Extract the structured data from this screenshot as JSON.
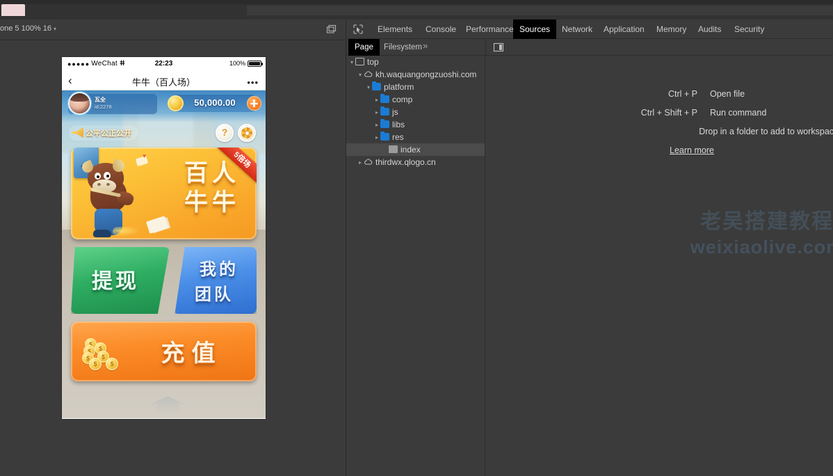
{
  "browser": {
    "tab_partial": ""
  },
  "device_bar": {
    "device_label": "one 5 100% 16",
    "caret": "▾",
    "screencast_icon": "screencast-icon"
  },
  "phone": {
    "status_bar": {
      "signal_dots": "●●●●●",
      "carrier": "WeChat",
      "wifi_icon": "ⵌ",
      "time": "22:23",
      "battery_percent": "100%"
    },
    "nav_bar": {
      "back_icon": "‹",
      "title": "牛牛（百人场）",
      "more_icon": "•••"
    },
    "hud": {
      "player_name": "瓦全",
      "player_id": "id:2278",
      "coin_amount": "50,000.00",
      "coin_plus": "+"
    },
    "notice": {
      "text": "公平公正公开",
      "help_label": "?",
      "settings_label": "gear"
    },
    "main_banner": {
      "title_line1": "百人",
      "title_line2": "牛牛",
      "ribbon": "5倍场"
    },
    "buttons": {
      "withdraw": "提现",
      "team_line1": "我的",
      "team_line2": "团队",
      "recharge": "充值"
    }
  },
  "devtools": {
    "inspect_icon": "inspect-element-icon",
    "tabs": [
      {
        "label": "Elements",
        "active": false
      },
      {
        "label": "Console",
        "active": false
      },
      {
        "label": "Performance",
        "active": false
      },
      {
        "label": "Sources",
        "active": true
      },
      {
        "label": "Network",
        "active": false
      },
      {
        "label": "Application",
        "active": false
      },
      {
        "label": "Memory",
        "active": false
      },
      {
        "label": "Audits",
        "active": false
      },
      {
        "label": "Security",
        "active": false
      }
    ],
    "sub_tabs": [
      {
        "label": "Page",
        "active": true
      },
      {
        "label": "Filesystem",
        "active": false
      }
    ],
    "sub_more": "»",
    "tree": [
      {
        "label": "top",
        "indent": 0,
        "twisty": "▾",
        "icon": "frame-icon",
        "selected": false
      },
      {
        "label": "kh.waquangongzuoshi.com",
        "indent": 1,
        "twisty": "▾",
        "icon": "cloud-icon",
        "selected": false
      },
      {
        "label": "platform",
        "indent": 2,
        "twisty": "▾",
        "icon": "folder-icon",
        "selected": false
      },
      {
        "label": "comp",
        "indent": 3,
        "twisty": "▸",
        "icon": "folder-icon",
        "selected": false
      },
      {
        "label": "js",
        "indent": 3,
        "twisty": "▸",
        "icon": "folder-icon",
        "selected": false
      },
      {
        "label": "libs",
        "indent": 3,
        "twisty": "▸",
        "icon": "folder-icon",
        "selected": false
      },
      {
        "label": "res",
        "indent": 3,
        "twisty": "▸",
        "icon": "folder-icon",
        "selected": false
      },
      {
        "label": "index",
        "indent": 4,
        "twisty": "",
        "icon": "file-icon",
        "selected": true
      },
      {
        "label": "thirdwx.qlogo.cn",
        "indent": 1,
        "twisty": "▸",
        "icon": "cloud-icon",
        "selected": false
      }
    ],
    "shortcuts": {
      "row1_key": "Ctrl + P",
      "row1_desc": "Open file",
      "row2_key": "Ctrl + Shift + P",
      "row2_desc": "Run command",
      "note": "Drop in a folder to add to workspace",
      "learn_more": "Learn more"
    }
  },
  "watermark": {
    "cn": "老吴搭建教程",
    "url": "weixiaolive.com"
  }
}
